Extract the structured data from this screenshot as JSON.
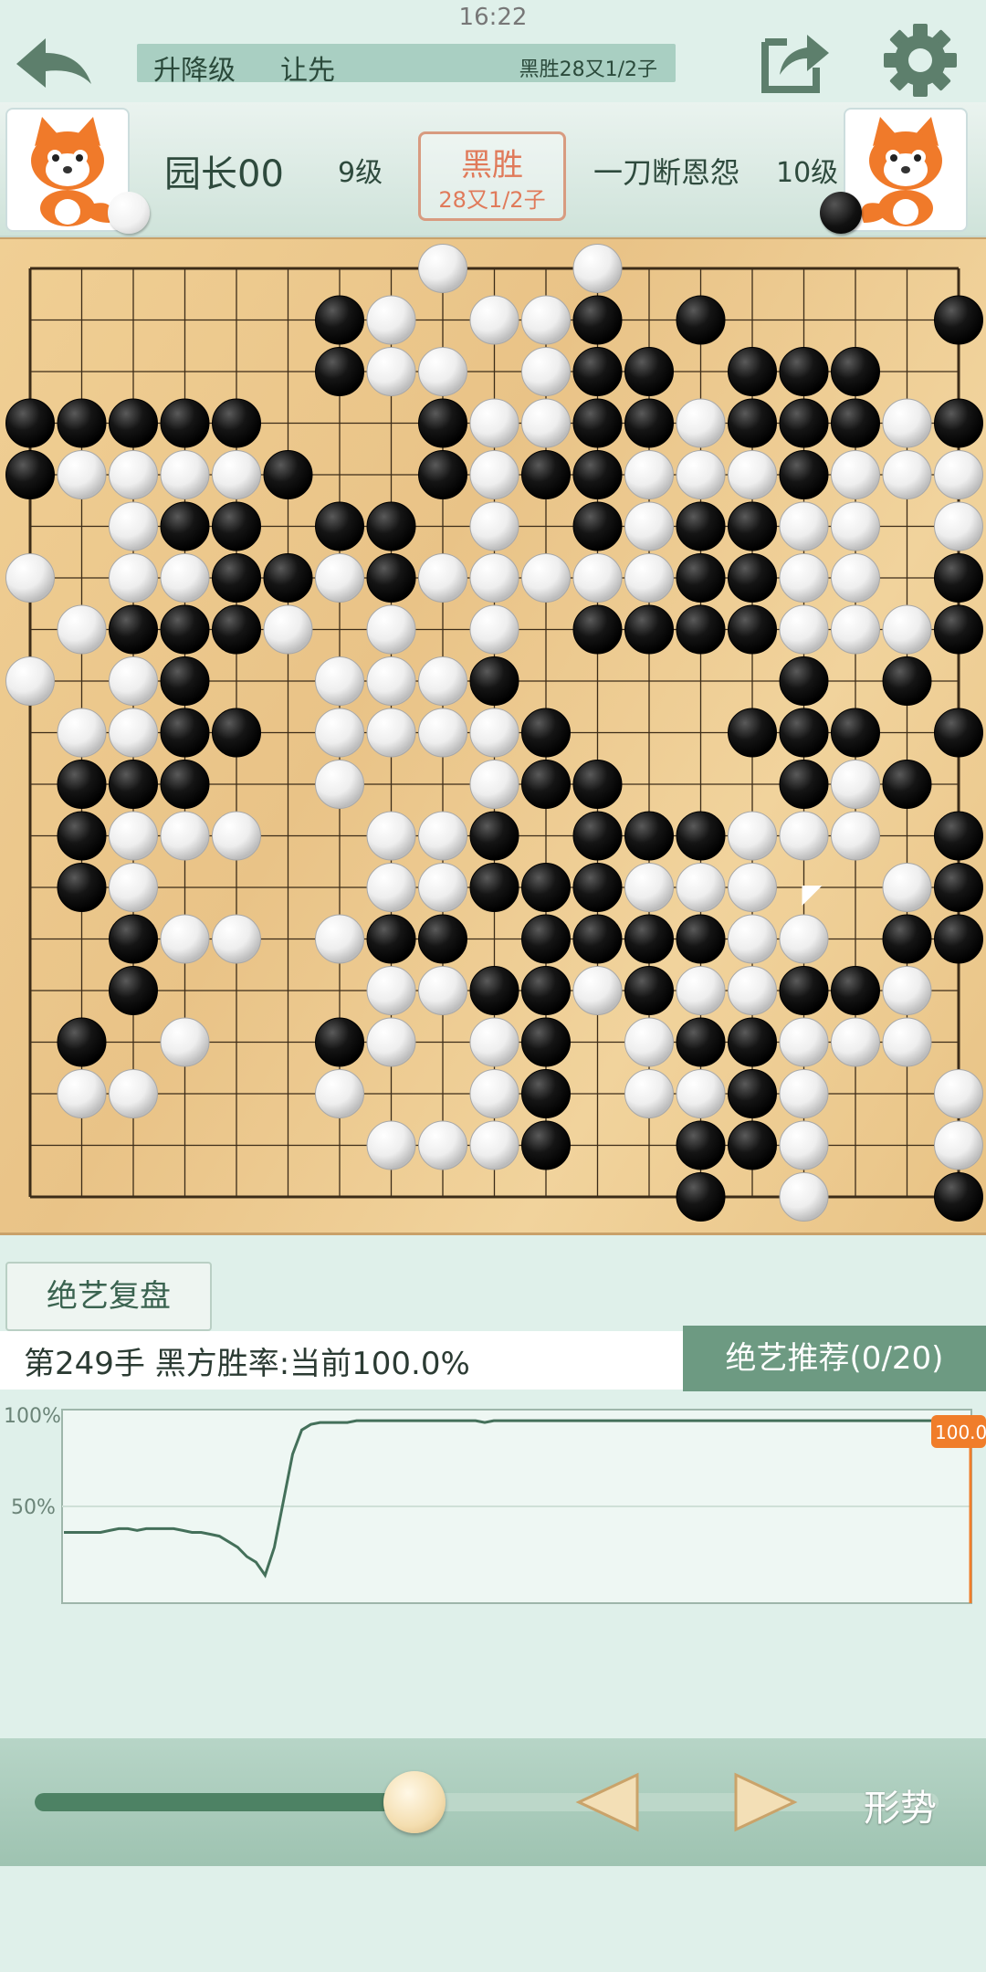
{
  "status": {
    "time": "16:22"
  },
  "mode_bar": {
    "label1": "升降级",
    "label2": "让先",
    "result": "黑胜28又1/2子"
  },
  "players": {
    "black": {
      "name": "园长00",
      "rank": "9级"
    },
    "white": {
      "name": "一刀断恩怨",
      "rank": "10级"
    }
  },
  "result_badge": {
    "main": "黑胜",
    "sub": "28又1/2子"
  },
  "board": {
    "size": 19,
    "rows": [
      "........W..W.......",
      "......BW.WWB.B....B",
      "......BWW.WBB.BBB..",
      "BBBBB...BWWBBWBBBWB",
      "BWWWWB..BWBBWWWBWWW",
      "..WBB.BB.W.BWBBWW.W",
      "W.WWBBWBWWWWWBBWW.B",
      ".WBBBW.W.W.BBBBWWWB",
      "W.WB..WWWB.....B.B.",
      ".WWBB.WWWWB...BBB.B",
      ".BBB..W..WBB...BWB.",
      ".BWWW..WWB.BBBWWW.B",
      ".BW....WWBBBWWW..WB",
      "..BWW.WBB.BBBBWW.BBB",
      "..B....WWBBWBWWBBW.",
      ".B.W..BW.WB.WBBWWW.",
      ".WW...W..WB.WWBW..W",
      ".......WWWB..BBW..W",
      ".............B.W..B"
    ],
    "last_move": "Q7"
  },
  "analysis": {
    "review_label": "绝艺复盘",
    "move_info": "第249手  黑方胜率:当前100.0%",
    "recommend_label": "绝艺推荐(0/20)"
  },
  "win_chart": {
    "y_labels": [
      "100%",
      "50%"
    ],
    "current_value": "100.0",
    "series": [
      38,
      38,
      38,
      38,
      38,
      39,
      40,
      40,
      39,
      40,
      40,
      40,
      40,
      39,
      38,
      38,
      37,
      36,
      33,
      30,
      25,
      22,
      15,
      30,
      55,
      80,
      93,
      96,
      97,
      97,
      97,
      97,
      98,
      98,
      98,
      98,
      98,
      98,
      98,
      98,
      98,
      98,
      98,
      98,
      98,
      98,
      97,
      98,
      98,
      98,
      98,
      98,
      98,
      98,
      98,
      98,
      98,
      98,
      98,
      98,
      98,
      98,
      98,
      98,
      98,
      98,
      98,
      98,
      98,
      98,
      98,
      98,
      98,
      98,
      98,
      98,
      98,
      98,
      98,
      98,
      98,
      98,
      98,
      98,
      98,
      98,
      98,
      98,
      98,
      98,
      98,
      98,
      98,
      98,
      98,
      98,
      98,
      98,
      98,
      98
    ]
  },
  "controls": {
    "progress": 0.42,
    "situation_label": "形势"
  },
  "colors": {
    "accent": "#6d9a82",
    "orange": "#f07d2a",
    "board": "#ecc78a"
  }
}
